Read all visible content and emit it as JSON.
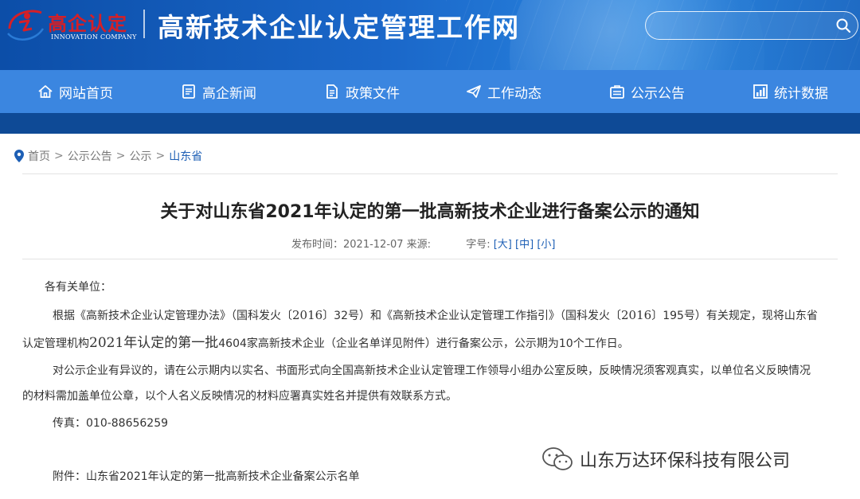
{
  "header": {
    "logo_cn": "高企认定",
    "logo_en": "INNOVATION COMPANY",
    "site_title": "高新技术企业认定管理工作网",
    "search_placeholder": ""
  },
  "nav": {
    "items": [
      {
        "label": "网站首页",
        "icon": "home-icon"
      },
      {
        "label": "高企新闻",
        "icon": "news-icon"
      },
      {
        "label": "政策文件",
        "icon": "document-icon"
      },
      {
        "label": "工作动态",
        "icon": "paper-plane-icon"
      },
      {
        "label": "公示公告",
        "icon": "announcement-icon"
      },
      {
        "label": "统计数据",
        "icon": "chart-icon"
      }
    ]
  },
  "breadcrumb": {
    "items": [
      "首页",
      "公示公告",
      "公示"
    ],
    "current": "山东省",
    "separator": ">"
  },
  "article": {
    "title": "关于对山东省2021年认定的第一批高新技术企业进行备案公示的通知",
    "meta_publish": "发布时间：2021-12-07 来源:",
    "meta_size_label": "字号:",
    "size_large": "[大]",
    "size_medium": "[中]",
    "size_small": "[小]",
    "salutation": "各有关单位：",
    "p1_line1_a": "根据《高新技术企业认定管理办法》（国科发火〔",
    "p1_line1_n1": "2016",
    "p1_line1_b": "〕32号）和《高新技术企业认定管理工作指引》（国科发火〔",
    "p1_line1_n2": "2016",
    "p1_line1_c": "〕195号）有关规定，现将山东省",
    "p1_line2_a": "认定管理机构",
    "p1_line2_big": "2021年认定的第一批",
    "p1_line2_b": "4604家高新技术企业（企业名单详见附件）进行备案公示，公示期为10个工作日。",
    "p2_line1": "对公示企业有异议的，请在公示期内以实名、书面形式向全国高新技术企业认定管理工作领导小组办公室反映，反映情况须客观真实，以单位名义反映情况",
    "p2_line2": "的材料需加盖单位公章，以个人名义反映情况的材料应署真实姓名并提供有效联系方式。",
    "fax": "传真：010-88656259",
    "attachment": "附件：山东省2021年认定的第一批高新技术企业备案公示名单"
  },
  "watermark": {
    "text": "山东万达环保科技有限公司"
  },
  "colors": {
    "header_bg": "#1a67c9",
    "nav_bg": "#3b86e0",
    "link_blue": "#1d5fb5",
    "logo_red": "#d61f26"
  }
}
